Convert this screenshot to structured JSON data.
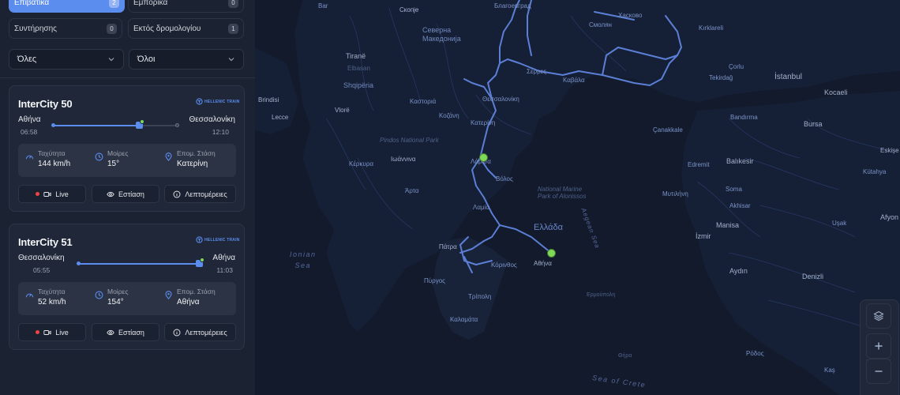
{
  "filters": {
    "passenger": {
      "label": "Επιβατικά",
      "count": "2"
    },
    "freight": {
      "label": "Εμπορικά",
      "count": "0"
    },
    "maintenance": {
      "label": "Συντήρησης",
      "count": "0"
    },
    "off_schedule": {
      "label": "Εκτός δρομολογίου",
      "count": "1"
    }
  },
  "selects": {
    "status": "Όλες",
    "operator": "Όλοι"
  },
  "brand": {
    "text": "HELLENIC TRAIN"
  },
  "trains": [
    {
      "title": "InterCity 50",
      "origin": "Αθήνα",
      "origin_time": "06:58",
      "destination": "Θεσσαλονίκη",
      "destination_time": "12:10",
      "progress": 0.69,
      "speed_label": "Ταχύτητα",
      "speed_value": "144 km/h",
      "heading_label": "Μοίρες",
      "heading_value": "15°",
      "next_stop_label": "Επομ. Στάση",
      "next_stop_value": "Κατερίνη",
      "live_label": "Live",
      "focus_label": "Εστίαση",
      "details_label": "Λεπτομέρειες"
    },
    {
      "title": "InterCity 51",
      "origin": "Θεσσαλονίκη",
      "origin_time": "05:55",
      "destination": "Αθήνα",
      "destination_time": "11:03",
      "progress": 0.97,
      "speed_label": "Ταχύτητα",
      "speed_value": "52 km/h",
      "heading_label": "Μοίρες",
      "heading_value": "154°",
      "next_stop_label": "Επομ. Στάση",
      "next_stop_value": "Αθήνα",
      "live_label": "Live",
      "focus_label": "Εστίαση",
      "details_label": "Λεπτομέρειες"
    }
  ],
  "map": {
    "labels": {
      "bar": "Bar",
      "skopje": "Скопје",
      "blagoevgrad": "Благоевград",
      "haskovo": "Хасково",
      "kirklareli": "Kırklareli",
      "north_macedonia": "Северна Македонија",
      "smolyan": "Смолян",
      "tirane": "Tiranë",
      "elbasan": "Elbasan",
      "corlu": "Çorlu",
      "serres": "Σέρρες",
      "tekirdag": "Tekirdağ",
      "istanbul": "İstanbul",
      "shqiperia": "Shqipëria",
      "kavala": "Καβάλα",
      "brindisi": "Brindisi",
      "kastoria": "Καστοριά",
      "thessaloniki": "Θεσσαλονίκη",
      "kocaeli": "Kocaeli",
      "vlore": "Vlorë",
      "kozani": "Κοζάνη",
      "lecce": "Lecce",
      "katerini": "Κατερίνη",
      "canakkale": "Çanakkale",
      "bandirma": "Bandırma",
      "bursa": "Bursa",
      "pindos": "Pindos National Park",
      "eskise": "Eskişe",
      "ioannina": "Ιωάννινα",
      "larisa": "Λάρισα",
      "balikesir": "Balıkesir",
      "kerkyra": "Κέρκυρα",
      "edremit": "Edremit",
      "kutahya": "Kütahya",
      "volos": "Βόλος",
      "alonissos": "National Marine\nPark of Alonissos",
      "soma": "Soma",
      "arta": "Άρτα",
      "aegean": "Aegean Sea",
      "mytilini": "Μυτιλήνη",
      "akhisar": "Akhisar",
      "lamia": "Λαμία",
      "usak": "Uşak",
      "afyon": "Afyon",
      "ellada": "Ελλάδα",
      "manisa": "Manisa",
      "izmir": "İzmir",
      "patra": "Πάτρα",
      "ionian": "Ionian\nSea",
      "korinthos": "Κόρινθος",
      "athina": "Αθήνα",
      "denizli": "Denizli",
      "aydin": "Aydın",
      "pyrgos": "Πύργος",
      "tripoli": "Τρίπολη",
      "ermoupoli": "Ερμούπολη",
      "kalamata": "Καλαμάτα",
      "thira": "Θήρα",
      "rodos": "Ρόδος",
      "crete": "Sea of Crete",
      "kas": "Kaş"
    }
  }
}
